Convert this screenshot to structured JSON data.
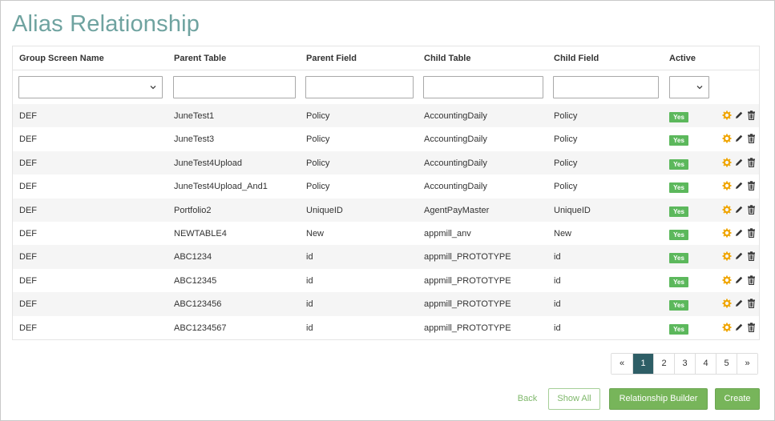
{
  "page": {
    "title": "Alias Relationship"
  },
  "table": {
    "columns": {
      "group_screen_name": "Group Screen Name",
      "parent_table": "Parent Table",
      "parent_field": "Parent Field",
      "child_table": "Child Table",
      "child_field": "Child Field",
      "active": "Active"
    },
    "filters": {
      "group_screen_name": "",
      "parent_table": "",
      "parent_field": "",
      "child_table": "",
      "child_field": "",
      "active": ""
    },
    "rows": [
      {
        "group": "DEF",
        "parent_table": "JuneTest1",
        "parent_field": "Policy",
        "child_table": "AccountingDaily",
        "child_field": "Policy",
        "active": "Yes"
      },
      {
        "group": "DEF",
        "parent_table": "JuneTest3",
        "parent_field": "Policy",
        "child_table": "AccountingDaily",
        "child_field": "Policy",
        "active": "Yes"
      },
      {
        "group": "DEF",
        "parent_table": "JuneTest4Upload",
        "parent_field": "Policy",
        "child_table": "AccountingDaily",
        "child_field": "Policy",
        "active": "Yes"
      },
      {
        "group": "DEF",
        "parent_table": "JuneTest4Upload_And1",
        "parent_field": "Policy",
        "child_table": "AccountingDaily",
        "child_field": "Policy",
        "active": "Yes"
      },
      {
        "group": "DEF",
        "parent_table": "Portfolio2",
        "parent_field": "UniqueID",
        "child_table": "AgentPayMaster",
        "child_field": "UniqueID",
        "active": "Yes"
      },
      {
        "group": "DEF",
        "parent_table": "NEWTABLE4",
        "parent_field": "New",
        "child_table": "appmill_anv",
        "child_field": "New",
        "active": "Yes"
      },
      {
        "group": "DEF",
        "parent_table": "ABC1234",
        "parent_field": "id",
        "child_table": "appmill_PROTOTYPE",
        "child_field": "id",
        "active": "Yes"
      },
      {
        "group": "DEF",
        "parent_table": "ABC12345",
        "parent_field": "id",
        "child_table": "appmill_PROTOTYPE",
        "child_field": "id",
        "active": "Yes"
      },
      {
        "group": "DEF",
        "parent_table": "ABC123456",
        "parent_field": "id",
        "child_table": "appmill_PROTOTYPE",
        "child_field": "id",
        "active": "Yes"
      },
      {
        "group": "DEF",
        "parent_table": "ABC1234567",
        "parent_field": "id",
        "child_table": "appmill_PROTOTYPE",
        "child_field": "id",
        "active": "Yes"
      }
    ],
    "row_icons": [
      "gear-icon",
      "pencil-icon",
      "trash-icon"
    ]
  },
  "pagination": {
    "prev": "«",
    "pages": [
      "1",
      "2",
      "3",
      "4",
      "5"
    ],
    "current": "1",
    "next": "»"
  },
  "actions": {
    "back": "Back",
    "show_all": "Show All",
    "relationship_builder": "Relationship Builder",
    "create": "Create"
  },
  "colors": {
    "title": "#6fa3a0",
    "active_badge": "#5cb85c",
    "primary_button": "#77b55a",
    "pager_active": "#2e5e66",
    "gear_icon": "#f0a500"
  }
}
